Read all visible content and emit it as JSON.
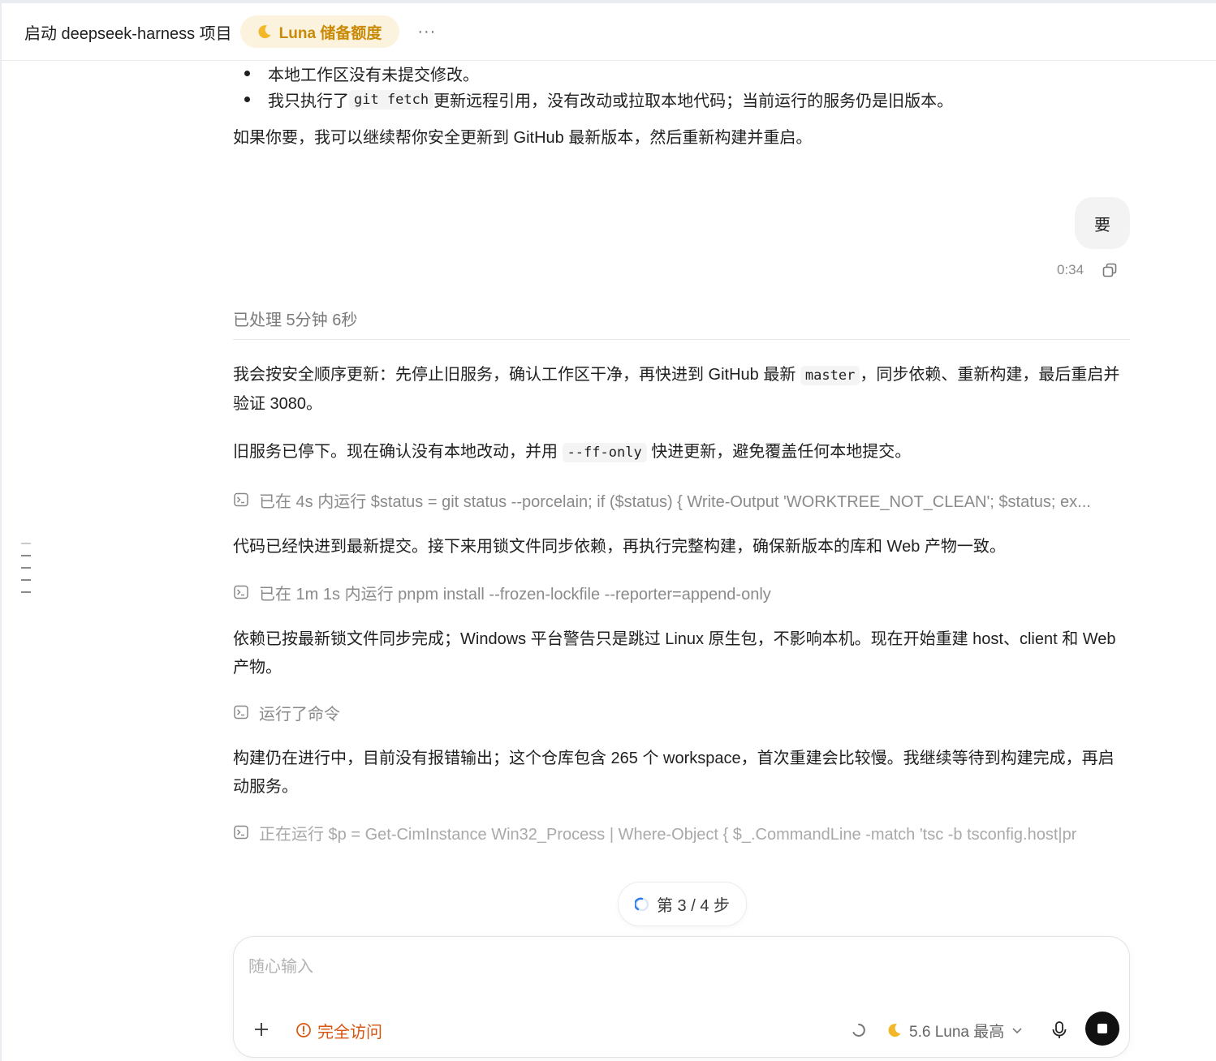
{
  "header": {
    "title": "启动 deepseek-harness 项目",
    "quota_label": "Luna 储备额度",
    "more": "···"
  },
  "messages": {
    "bullet1": "本地工作区没有未提交修改。",
    "bullet2_before": "我只执行了 ",
    "bullet2_code": "git fetch",
    "bullet2_after": " 更新远程引用，没有改动或拉取本地代码；当前运行的服务仍是旧版本。",
    "offer": "如果你要，我可以继续帮你安全更新到 GitHub 最新版本，然后重新构建并重启。",
    "user_reply": "要",
    "user_time": "0:34",
    "processed": "已处理 5分钟 6秒",
    "p1_before": "我会按安全顺序更新：先停止旧服务，确认工作区干净，再快进到 GitHub 最新 ",
    "p1_code": "master",
    "p1_after": "，同步依赖、重新构建，最后重启并验证 3080。",
    "p2_before": "旧服务已停下。现在确认没有本地改动，并用 ",
    "p2_code": "--ff-only",
    "p2_after": " 快进更新，避免覆盖任何本地提交。",
    "cmd1": "已在 4s 内运行 $status = git status --porcelain; if ($status) { Write-Output 'WORKTREE_NOT_CLEAN'; $status; ex...",
    "p3": "代码已经快进到最新提交。接下来用锁文件同步依赖，再执行完整构建，确保新版本的库和 Web 产物一致。",
    "cmd2": "已在 1m 1s 内运行 pnpm install --frozen-lockfile --reporter=append-only",
    "p4": "依赖已按最新锁文件同步完成；Windows 平台警告只是跳过 Linux 原生包，不影响本机。现在开始重建 host、client 和 Web 产物。",
    "cmd3": "运行了命令",
    "p5": "构建仍在进行中，目前没有报错输出；这个仓库包含 265 个 workspace，首次重建会比较慢。我继续等待到构建完成，再启动服务。",
    "cmd4": "正在运行 $p = Get-CimInstance Win32_Process | Where-Object { $_.CommandLine -match 'tsc -b tsconfig.host|pr"
  },
  "step": {
    "label": "第 3 / 4 步",
    "current": 3,
    "total": 4
  },
  "composer": {
    "placeholder": "随心输入",
    "access_label": "完全访问",
    "model_label": "5.6 Luna 最高"
  },
  "colors": {
    "accent_gold": "#c98a07",
    "badge_bg": "#fcf3de",
    "warning_orange": "#d9540f",
    "text": "#1f1f1f",
    "muted": "#8a8a8a"
  },
  "icons": {
    "quota": "moon-icon",
    "more": "more-icon",
    "copy": "copy-icon",
    "terminal": "terminal-icon",
    "spinner": "spinner-icon",
    "plus": "plus-icon",
    "warning": "warning-icon",
    "chevron": "chevron-down-icon",
    "mic": "mic-icon",
    "stop": "stop-icon"
  }
}
